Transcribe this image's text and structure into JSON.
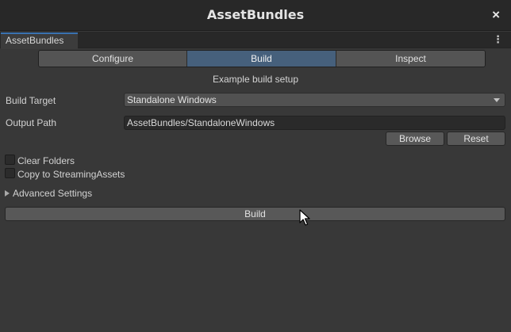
{
  "window": {
    "title": "AssetBundles",
    "close_symbol": "×"
  },
  "tab": {
    "label": "AssetBundles",
    "menu_symbol": "⋮"
  },
  "modes": [
    {
      "label": "Configure",
      "active": false
    },
    {
      "label": "Build",
      "active": true
    },
    {
      "label": "Inspect",
      "active": false
    }
  ],
  "caption": "Example build setup",
  "build_target": {
    "label": "Build Target",
    "value": "Standalone Windows"
  },
  "output_path": {
    "label": "Output Path",
    "value": "AssetBundles/StandaloneWindows"
  },
  "buttons": {
    "browse": "Browse",
    "reset": "Reset",
    "build": "Build"
  },
  "options": {
    "clear_folders": {
      "label": "Clear Folders",
      "checked": false
    },
    "copy_streaming": {
      "label": "Copy to StreamingAssets",
      "checked": false
    }
  },
  "advanced": {
    "label": "Advanced Settings",
    "expanded": false
  },
  "colors": {
    "active_tab": "#46607c",
    "tab_accent": "#3a72b0",
    "background": "#383838"
  }
}
